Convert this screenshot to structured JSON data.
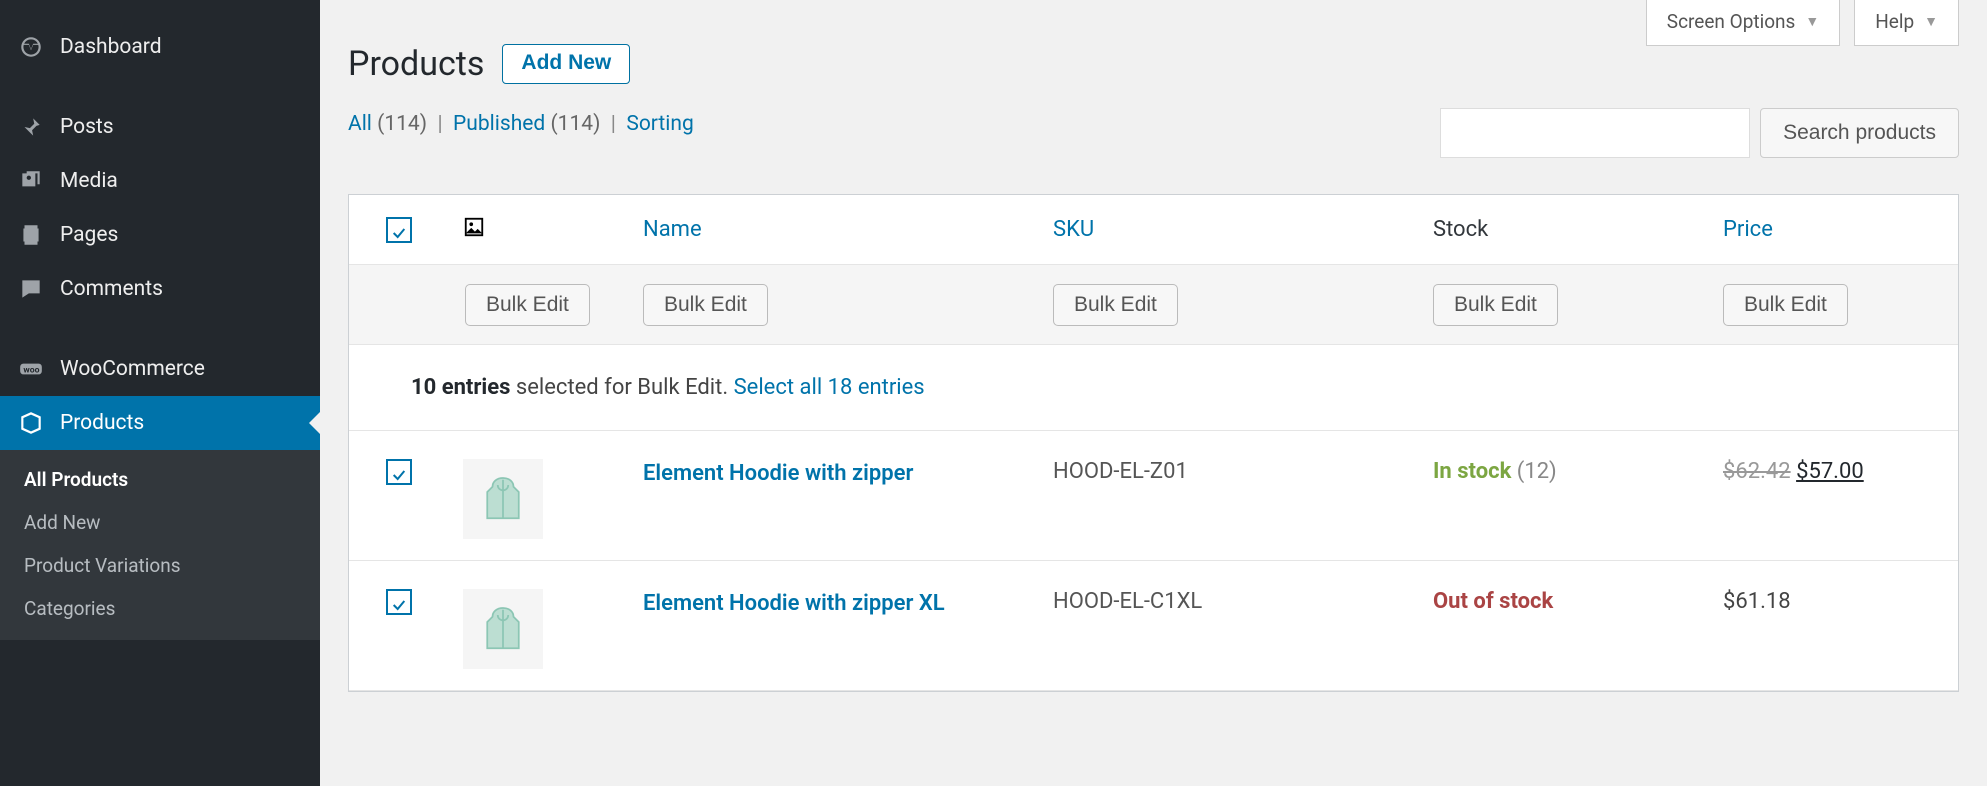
{
  "sidebar": {
    "items": [
      {
        "label": "Dashboard",
        "icon": "dashboard"
      },
      {
        "label": "Posts",
        "icon": "pin"
      },
      {
        "label": "Media",
        "icon": "media"
      },
      {
        "label": "Pages",
        "icon": "pages"
      },
      {
        "label": "Comments",
        "icon": "comment"
      },
      {
        "label": "WooCommerce",
        "icon": "woo"
      },
      {
        "label": "Products",
        "icon": "box",
        "active": true
      }
    ],
    "submenu": [
      {
        "label": "All Products",
        "current": true
      },
      {
        "label": "Add New"
      },
      {
        "label": "Product Variations"
      },
      {
        "label": "Categories"
      }
    ]
  },
  "topTabs": {
    "screenOptions": "Screen Options",
    "help": "Help"
  },
  "header": {
    "title": "Products",
    "addNew": "Add New"
  },
  "filters": {
    "all": "All",
    "allCount": "(114)",
    "published": "Published",
    "publishedCount": "(114)",
    "sorting": "Sorting",
    "sep": "|"
  },
  "search": {
    "button": "Search products"
  },
  "table": {
    "headers": {
      "name": "Name",
      "sku": "SKU",
      "stock": "Stock",
      "price": "Price"
    },
    "bulkEditLabel": "Bulk Edit",
    "selection": {
      "countStrong": "10 entries",
      "rest": " selected for Bulk Edit. ",
      "link": "Select all 18 entries"
    },
    "rows": [
      {
        "name": "Element Hoodie with zipper",
        "sku": "HOOD-EL-Z01",
        "stockStatus": "In stock",
        "stockCount": "(12)",
        "priceOld": "$62.42",
        "priceNew": "$57.00"
      },
      {
        "name": "Element Hoodie with zipper XL",
        "sku": "HOOD-EL-C1XL",
        "stockStatus": "Out of stock",
        "price": "$61.18"
      }
    ]
  }
}
